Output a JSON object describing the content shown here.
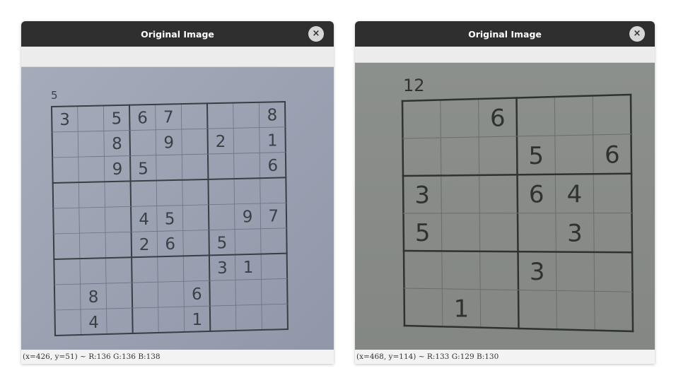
{
  "windows": [
    {
      "title": "Original Image",
      "close_label": "×",
      "status": "(x=426, y=51) ~ R:136 G:136 B:138",
      "page_label": "5",
      "cells": [
        [
          "3",
          "",
          "5",
          "6",
          "7",
          "",
          "",
          "",
          "8"
        ],
        [
          "",
          "",
          "8",
          "",
          "9",
          "",
          "2",
          "",
          "1"
        ],
        [
          "",
          "",
          "9",
          "5",
          "",
          "",
          "",
          "",
          "6"
        ],
        [
          "",
          "",
          "",
          "",
          "",
          "",
          "",
          "",
          ""
        ],
        [
          "",
          "",
          "",
          "4",
          "5",
          "",
          "",
          "9",
          "7"
        ],
        [
          "",
          "",
          "",
          "2",
          "6",
          "",
          "5",
          "",
          ""
        ],
        [
          "",
          "",
          "",
          "",
          "",
          "",
          "3",
          "1",
          ""
        ],
        [
          "",
          "8",
          "",
          "",
          "",
          "6",
          "",
          "",
          ""
        ],
        [
          "",
          "4",
          "",
          "",
          "",
          "1",
          "",
          "",
          ""
        ]
      ]
    },
    {
      "title": "Original Image",
      "close_label": "×",
      "status": "(x=468, y=114) ~ R:133 G:129 B:130",
      "page_label": "12",
      "cells": [
        [
          "",
          "",
          "6",
          "",
          "",
          ""
        ],
        [
          "",
          "",
          "",
          "5",
          "",
          "6"
        ],
        [
          "3",
          "",
          "",
          "6",
          "4",
          ""
        ],
        [
          "5",
          "",
          "",
          "",
          "3",
          ""
        ],
        [
          "",
          "",
          "",
          "3",
          "",
          ""
        ],
        [
          "",
          "1",
          "",
          "",
          "",
          ""
        ]
      ]
    }
  ]
}
